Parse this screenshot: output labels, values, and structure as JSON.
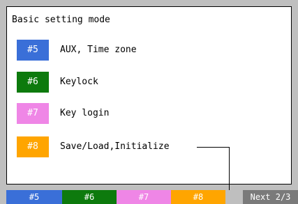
{
  "screen": {
    "title": "Basic setting mode"
  },
  "menu": [
    {
      "code": "#5",
      "label": "AUX, Time zone",
      "color": "#3a6fd8"
    },
    {
      "code": "#6",
      "label": "Keylock",
      "color": "#0d7a0d"
    },
    {
      "code": "#7",
      "label": "Key login",
      "color": "#ef86e6"
    },
    {
      "code": "#8",
      "label": "Save/Load,Initialize",
      "color": "#ffa500"
    }
  ],
  "softkeys": [
    {
      "label": "#5",
      "color": "#3a6fd8"
    },
    {
      "label": "#6",
      "color": "#0d7a0d"
    },
    {
      "label": "#7",
      "color": "#ef86e6"
    },
    {
      "label": "#8",
      "color": "#ffa500"
    }
  ],
  "next_key": {
    "label": "Next 2/3",
    "color": "#7a7a7a"
  }
}
